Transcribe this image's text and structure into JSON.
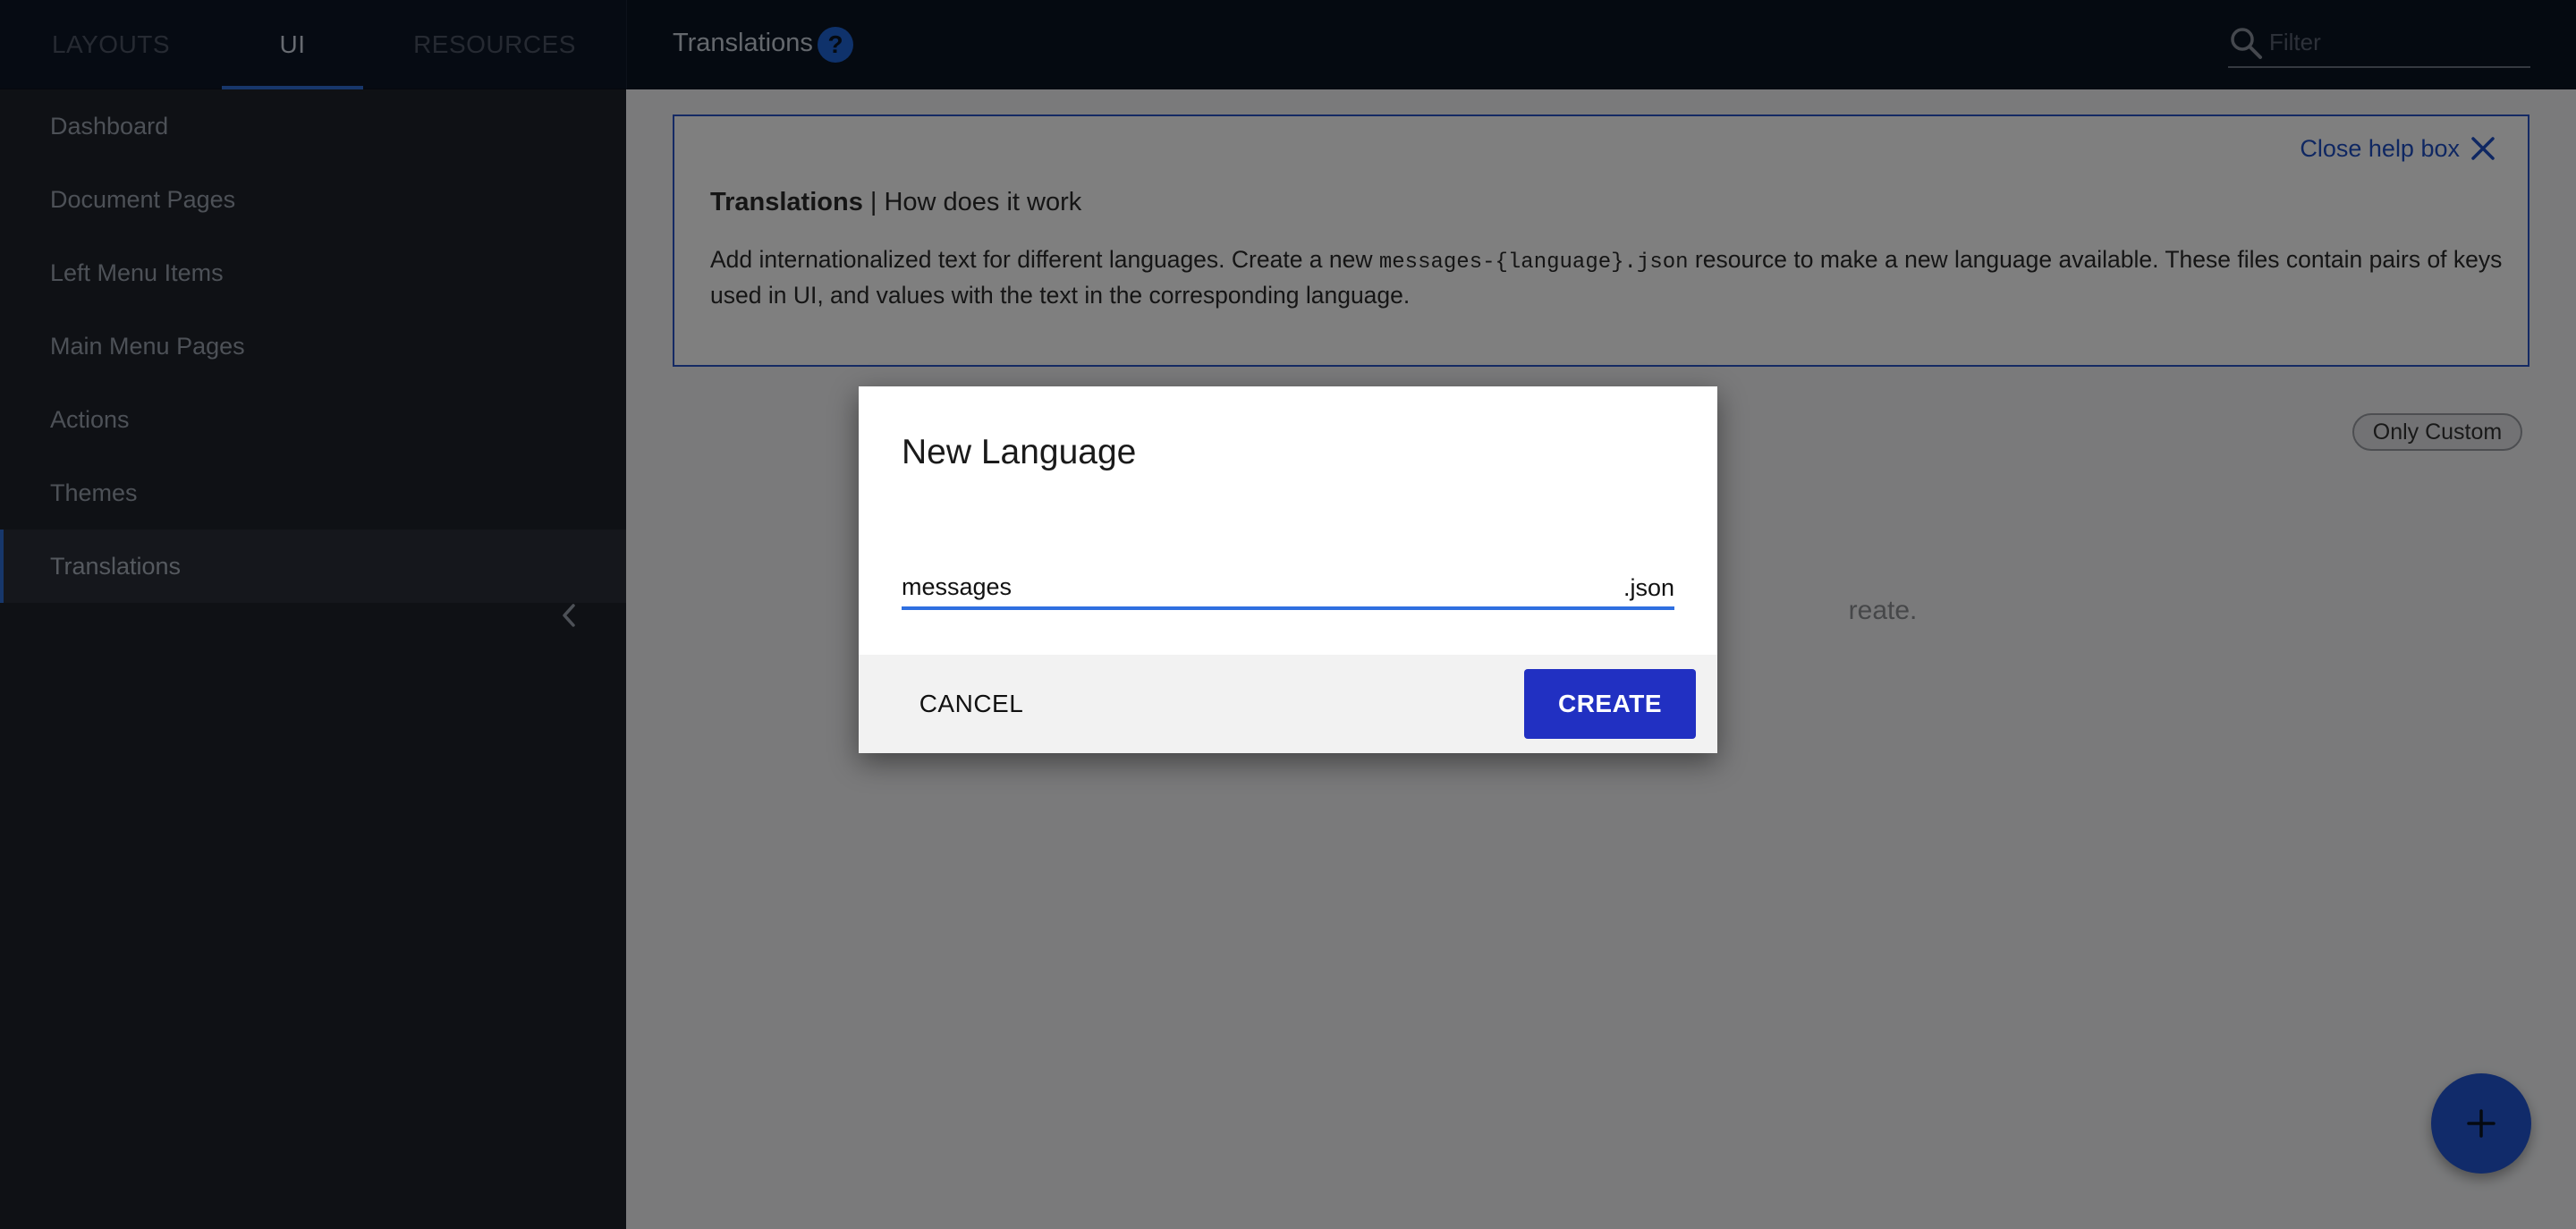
{
  "sidebar": {
    "tabs": [
      {
        "label": "LAYOUTS",
        "active": false
      },
      {
        "label": "UI",
        "active": true
      },
      {
        "label": "RESOURCES",
        "active": false
      }
    ],
    "items": [
      {
        "label": "Dashboard"
      },
      {
        "label": "Document Pages"
      },
      {
        "label": "Left Menu Items"
      },
      {
        "label": "Main Menu Pages"
      },
      {
        "label": "Actions"
      },
      {
        "label": "Themes"
      },
      {
        "label": "Translations",
        "active": true
      }
    ],
    "collapse_icon": "chevron-left-icon"
  },
  "topbar": {
    "title": "Translations",
    "help_glyph": "?",
    "filter": {
      "placeholder": "Filter",
      "value": "",
      "icon": "search-icon"
    }
  },
  "help_box": {
    "close_label": "Close help box",
    "heading_bold": "Translations",
    "heading_rest": " | How does it work",
    "text_1": "Add internationalized text for different languages. Create a new ",
    "code": "messages-{language}.json",
    "text_2": " resource to make a new language available. These files contain pairs of keys used in UI, and values with the text in the corresponding language."
  },
  "toolbar": {
    "only_custom_label": "Only Custom"
  },
  "empty_state": {
    "text_visible_fragment": "reate."
  },
  "fab": {
    "icon": "plus-icon"
  },
  "dialog": {
    "title": "New Language",
    "input_value": "messages",
    "input_suffix": ".json",
    "cancel_label": "CANCEL",
    "create_label": "CREATE"
  },
  "colors": {
    "accent": "#2f6fd6",
    "create_button": "#2130c2",
    "sidebar_bg": "#1e222b",
    "topbar_bg": "#0b1523",
    "help_border": "#2a55c8"
  }
}
